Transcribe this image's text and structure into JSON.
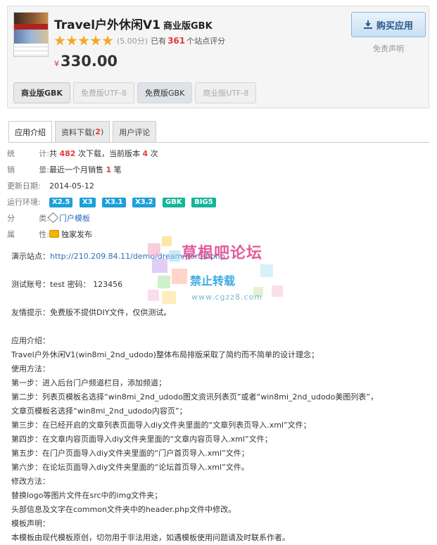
{
  "product": {
    "title": "Travel户外休闲V1",
    "edition": "商业版GBK",
    "stars": 5,
    "score_text": "(5.00分)",
    "rating_prefix": "已有",
    "rating_count": "361",
    "rating_suffix": "个站点评分",
    "currency": "¥",
    "price": "330.00",
    "buy_label": "购买应用",
    "disclaimer": "免责声明",
    "editions": [
      "商业版GBK",
      "免费版UTF-8",
      "免费版GBK",
      "商业版UTF-8"
    ]
  },
  "tabs": {
    "intro": "应用介绍",
    "download_label": "资料下载(",
    "download_count": "2",
    "download_close": ")",
    "reviews": "用户评论"
  },
  "info": {
    "stats_label_a": "统",
    "stats_label_b": "计:",
    "stats_text_1": "共",
    "stats_downloads": "482",
    "stats_text_2": "次下载，当前版本",
    "stats_version": "4",
    "stats_text_3": "次",
    "sales_label_a": "销",
    "sales_label_b": "量:",
    "sales_text_1": "最近一个月销售",
    "sales_count": "1",
    "sales_text_2": "笔",
    "updated_label": "更新日期:",
    "updated_value": "2014-05-12",
    "env_label": "运行环境:",
    "env_tags": [
      "X2.5",
      "X3",
      "X3.1",
      "X3.2",
      "GBK",
      "BIG5"
    ],
    "category_label_a": "分",
    "category_label_b": "类:",
    "category_value": "门户模板",
    "attr_label_a": "属",
    "attr_label_b": "性:",
    "attr_value": "独家发布"
  },
  "description": {
    "demo_label": "演示站点：",
    "demo_url": "http://210.209.84.11/demo/dream/portal.php",
    "test_account": "测试账号：test 密码： 123456",
    "notice": "友情提示：免费版不提供DIY文件，仅供测试。",
    "intro_heading": "应用介绍：",
    "intro_text": "Travel户外休闲V1(win8mi_2nd_udodo)整体布局排版采取了简约而不简单的设计理念；",
    "usage_heading": "使用方法：",
    "steps": [
      "第一步：进入后台门户频道栏目，添加频道；",
      "第二步：列表页模板名选择“win8mi_2nd_udodo图文资讯列表页”或者“win8mi_2nd_udodo美图列表”，",
      "文章页模板名选择“win8mi_2nd_udodo内容页”；",
      "第三步：在已经开启的文章列表页面导入diy文件夹里面的“文章列表页导入.xml”文件；",
      "第四步：在文章内容页面导入diy文件夹里面的“文章内容页导入.xml”文件；",
      "第五步：在门户页面导入diy文件夹里面的“门户首页导入.xml”文件；",
      "第六步：在论坛页面导入diy文件夹里面的“论坛首页导入.xml”文件。"
    ],
    "modify_heading": "修改方法：",
    "modify_lines": [
      "替换logo等图片文件在src中的img文件夹；",
      "头部信息及文字在common文件夹中的header.php文件中修改。"
    ],
    "statement_heading": "模板声明：",
    "statement_text": "本模板由现代模板原创，切勿用于非法用途，如遇模板使用问题请及时联系作者。"
  },
  "watermark": {
    "title": "草根吧论坛",
    "subtitle": "禁止转载",
    "url": "www.cgzz8.com"
  },
  "colors": {
    "accent_red": "#e4393c",
    "link_blue": "#2a6ebb",
    "env_blue": "#1da0d8",
    "env_green": "#15b59a",
    "star": "#f5a623"
  }
}
